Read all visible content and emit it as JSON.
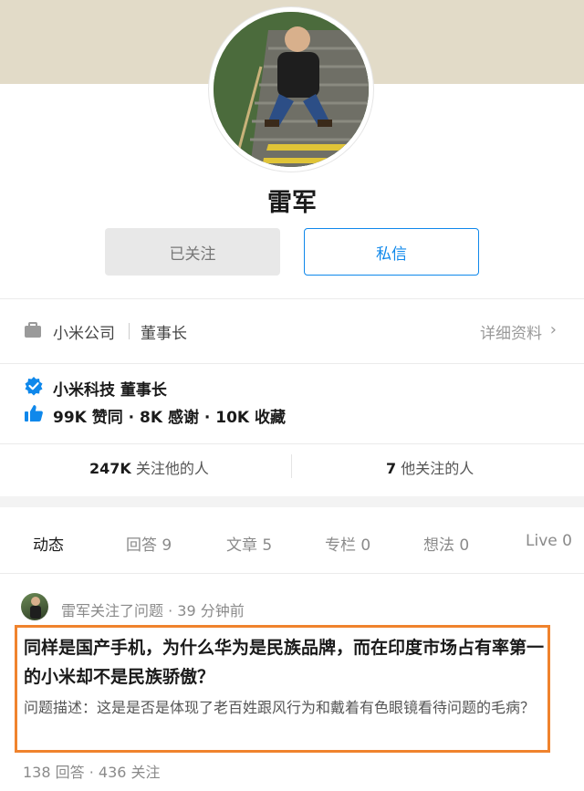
{
  "profile": {
    "name": "雷军",
    "follow_button": "已关注",
    "message_button": "私信",
    "company": "小米公司",
    "position": "董事长",
    "detail_link": "详细资料",
    "verified_text": "小米科技 董事长",
    "stats_text": "99K 赞同 · 8K 感谢 · 10K 收藏",
    "followers_count": "247K",
    "followers_label": "关注他的人",
    "following_count": "7",
    "following_label": "他关注的人"
  },
  "tabs": [
    {
      "label": "动态"
    },
    {
      "label": "回答 9"
    },
    {
      "label": "文章 5"
    },
    {
      "label": "专栏 0"
    },
    {
      "label": "想法 0"
    },
    {
      "label": "Live 0"
    }
  ],
  "feed": {
    "meta": "雷军关注了问题 · 39 分钟前",
    "question_title": "同样是国产手机，为什么华为是民族品牌，而在印度市场占有率第一的小米却不是民族骄傲？",
    "question_desc": "问题描述：这是是否是体现了老百姓跟风行为和戴着有色眼镜看待问题的毛病？",
    "footer": "138 回答 · 436 关注"
  },
  "colors": {
    "accent": "#0f88eb",
    "highlight": "#f0832d",
    "cover": "#e2dbc8"
  },
  "icons": {
    "briefcase": "briefcase-icon",
    "verified": "verified-badge-icon",
    "thumbs_up": "thumbs-up-icon",
    "chevron": "chevron-right-icon"
  }
}
